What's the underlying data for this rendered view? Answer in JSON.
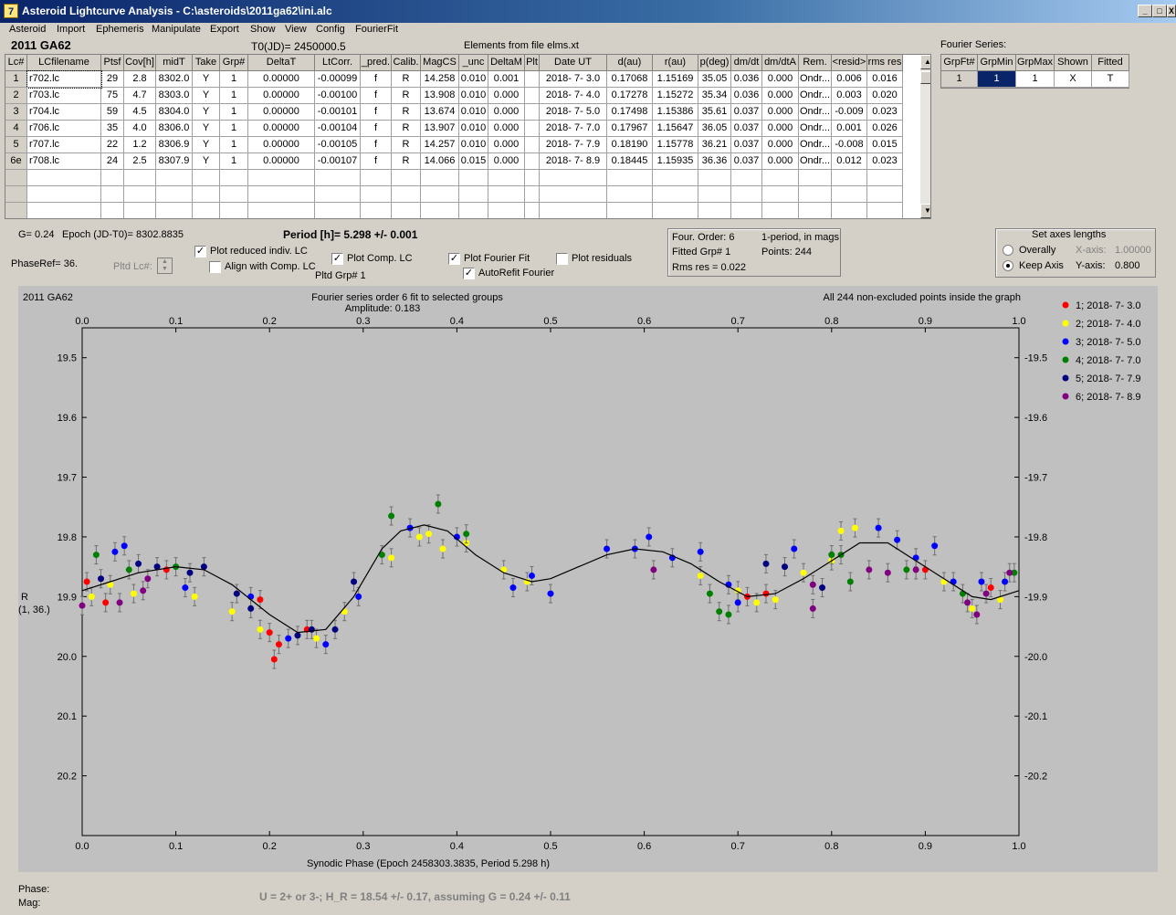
{
  "window": {
    "title": "Asteroid Lightcurve Analysis - C:\\asteroids\\2011ga62\\ini.alc",
    "min": "_",
    "max": "□",
    "close": "X"
  },
  "menu": [
    "Asteroid",
    "Import",
    "Ephemeris",
    "Manipulate",
    "Export",
    "Show",
    "View",
    "Config",
    "FourierFit"
  ],
  "header": {
    "asteroid": "2011 GA62",
    "t0": "T0(JD)= 2450000.5",
    "elements": "Elements from file elms.xt",
    "fourier_series": "Fourier Series:"
  },
  "table": {
    "columns": [
      "Lc#",
      "LCfilename",
      "Ptsf",
      "Cov[h]",
      "midT",
      "Take",
      "Grp#",
      "DeltaT",
      "LtCorr.",
      "_pred.",
      "Calib.",
      "MagCS",
      "_unc",
      "DeltaM",
      "Plt",
      "Date UT",
      "d(au)",
      "r(au)",
      "p(deg)",
      "dm/dt",
      "dm/dtA",
      "Rem.",
      "<resid>",
      "rms res"
    ],
    "rows": [
      [
        "1",
        "r702.lc",
        "29",
        "2.8",
        "8302.0",
        "Y",
        "1",
        "0.00000",
        "-0.00099",
        "f",
        "R",
        "14.258",
        "0.010",
        "0.001",
        "",
        "2018- 7- 3.0",
        "0.17068",
        "1.15169",
        "35.05",
        "0.036",
        "0.000",
        "Ondr...",
        "0.006",
        "0.016"
      ],
      [
        "2",
        "r703.lc",
        "75",
        "4.7",
        "8303.0",
        "Y",
        "1",
        "0.00000",
        "-0.00100",
        "f",
        "R",
        "13.908",
        "0.010",
        "0.000",
        "",
        "2018- 7- 4.0",
        "0.17278",
        "1.15272",
        "35.34",
        "0.036",
        "0.000",
        "Ondr...",
        "0.003",
        "0.020"
      ],
      [
        "3",
        "r704.lc",
        "59",
        "4.5",
        "8304.0",
        "Y",
        "1",
        "0.00000",
        "-0.00101",
        "f",
        "R",
        "13.674",
        "0.010",
        "0.000",
        "",
        "2018- 7- 5.0",
        "0.17498",
        "1.15386",
        "35.61",
        "0.037",
        "0.000",
        "Ondr...",
        "-0.009",
        "0.023"
      ],
      [
        "4",
        "r706.lc",
        "35",
        "4.0",
        "8306.0",
        "Y",
        "1",
        "0.00000",
        "-0.00104",
        "f",
        "R",
        "13.907",
        "0.010",
        "0.000",
        "",
        "2018- 7- 7.0",
        "0.17967",
        "1.15647",
        "36.05",
        "0.037",
        "0.000",
        "Ondr...",
        "0.001",
        "0.026"
      ],
      [
        "5",
        "r707.lc",
        "22",
        "1.2",
        "8306.9",
        "Y",
        "1",
        "0.00000",
        "-0.00105",
        "f",
        "R",
        "14.257",
        "0.010",
        "0.000",
        "",
        "2018- 7- 7.9",
        "0.18190",
        "1.15778",
        "36.21",
        "0.037",
        "0.000",
        "Ondr...",
        "-0.008",
        "0.015"
      ],
      [
        "6e",
        "r708.lc",
        "24",
        "2.5",
        "8307.9",
        "Y",
        "1",
        "0.00000",
        "-0.00107",
        "f",
        "R",
        "14.066",
        "0.015",
        "0.000",
        "",
        "2018- 7- 8.9",
        "0.18445",
        "1.15935",
        "36.36",
        "0.037",
        "0.000",
        "Ondr...",
        "0.012",
        "0.023"
      ]
    ]
  },
  "fourier_table": {
    "columns": [
      "GrpFt#",
      "GrpMin",
      "GrpMax",
      "Shown",
      "Fitted"
    ],
    "row": [
      "1",
      "1",
      "1",
      "X",
      "T"
    ]
  },
  "controls": {
    "g": "G= 0.24",
    "epoch": "Epoch (JD-T0)= 8302.8835",
    "period": "Period [h]= 5.298 +/- 0.001",
    "phaseref": "PhaseRef= 36.",
    "pltd_lc": "Pltd Lc#:",
    "plot_reduced": "Plot reduced indiv. LC",
    "align_comp": "Align with Comp. LC",
    "plot_comp": "Plot Comp. LC",
    "pltd_grp": "Pltd Grp#  1",
    "plot_fourier": "Plot Fourier Fit",
    "autorefit": "AutoRefit Fourier",
    "plot_residuals": "Plot residuals",
    "four_order": "Four. Order:  6",
    "one_period": "1-period, in mags",
    "fitted_grp": "Fitted Grp# 1",
    "points": "Points: 244",
    "rms_res": "Rms res      = 0.022",
    "axes_title": "Set axes lengths",
    "overally": "Overally",
    "keep_axis": "Keep Axis",
    "xaxis_label": "X-axis:",
    "xaxis_val": "1.00000",
    "yaxis_label": "Y-axis:",
    "yaxis_val": "0.800"
  },
  "footer": {
    "phase": "Phase:",
    "mag": "Mag:",
    "result": "U = 2+ or 3-; H_R = 18.54 +/- 0.17, assuming G = 0.24 +/- 0.11"
  },
  "colors": {
    "red": "#ff0000",
    "yellow": "#ffff00",
    "blue": "#0000ff",
    "green": "#008000",
    "navy": "#000080",
    "purple": "#800080"
  },
  "chart_data": {
    "type": "scatter",
    "corner_label": "2011 GA62",
    "title": "Fourier series order 6 fit to selected groups",
    "subtitle": "Amplitude: 0.183",
    "note": "All 244 non-excluded points inside the graph",
    "xlabel": "Synodic Phase (Epoch 2458303.3835, Period 5.298 h)",
    "ylabel": "R",
    "ylabel2": "(1, 36.)",
    "xlim": [
      0,
      1
    ],
    "ylim": [
      19.45,
      20.3
    ],
    "y_inverted": true,
    "xticks": [
      "0.0",
      "0.1",
      "0.2",
      "0.3",
      "0.4",
      "0.5",
      "0.6",
      "0.7",
      "0.8",
      "0.9",
      "1.0"
    ],
    "yticks": [
      "19.5",
      "19.6",
      "19.7",
      "19.8",
      "19.9",
      "20.0",
      "20.1",
      "20.2"
    ],
    "legend": [
      {
        "name": "1; 2018- 7- 3.0",
        "color": "#ff0000"
      },
      {
        "name": "2; 2018- 7- 4.0",
        "color": "#ffff00"
      },
      {
        "name": "3; 2018- 7- 5.0",
        "color": "#0000ff"
      },
      {
        "name": "4; 2018- 7- 7.0",
        "color": "#008000"
      },
      {
        "name": "5; 2018- 7- 7.9",
        "color": "#000080"
      },
      {
        "name": "6; 2018- 7- 8.9",
        "color": "#800080"
      }
    ],
    "fit_curve": [
      [
        0.0,
        19.89
      ],
      [
        0.03,
        19.875
      ],
      [
        0.06,
        19.86
      ],
      [
        0.1,
        19.85
      ],
      [
        0.13,
        19.855
      ],
      [
        0.16,
        19.88
      ],
      [
        0.2,
        19.93
      ],
      [
        0.23,
        19.96
      ],
      [
        0.26,
        19.955
      ],
      [
        0.29,
        19.9
      ],
      [
        0.32,
        19.82
      ],
      [
        0.34,
        19.79
      ],
      [
        0.365,
        19.78
      ],
      [
        0.39,
        19.79
      ],
      [
        0.42,
        19.83
      ],
      [
        0.45,
        19.86
      ],
      [
        0.48,
        19.875
      ],
      [
        0.5,
        19.87
      ],
      [
        0.53,
        19.85
      ],
      [
        0.56,
        19.83
      ],
      [
        0.59,
        19.82
      ],
      [
        0.62,
        19.825
      ],
      [
        0.65,
        19.845
      ],
      [
        0.68,
        19.875
      ],
      [
        0.71,
        19.9
      ],
      [
        0.74,
        19.895
      ],
      [
        0.77,
        19.87
      ],
      [
        0.8,
        19.84
      ],
      [
        0.83,
        19.81
      ],
      [
        0.86,
        19.81
      ],
      [
        0.89,
        19.84
      ],
      [
        0.92,
        19.87
      ],
      [
        0.95,
        19.9
      ],
      [
        0.97,
        19.905
      ],
      [
        1.0,
        19.89
      ]
    ],
    "points": [
      {
        "g": 1,
        "x": 0.005,
        "y": 19.875
      },
      {
        "g": 1,
        "x": 0.025,
        "y": 19.91
      },
      {
        "g": 1,
        "x": 0.09,
        "y": 19.855
      },
      {
        "g": 1,
        "x": 0.19,
        "y": 19.905
      },
      {
        "g": 1,
        "x": 0.2,
        "y": 19.96
      },
      {
        "g": 1,
        "x": 0.205,
        "y": 20.005
      },
      {
        "g": 1,
        "x": 0.21,
        "y": 19.98
      },
      {
        "g": 1,
        "x": 0.24,
        "y": 19.955
      },
      {
        "g": 1,
        "x": 0.71,
        "y": 19.9
      },
      {
        "g": 1,
        "x": 0.73,
        "y": 19.895
      },
      {
        "g": 1,
        "x": 0.9,
        "y": 19.855
      },
      {
        "g": 1,
        "x": 0.97,
        "y": 19.885
      },
      {
        "g": 2,
        "x": 0.01,
        "y": 19.9
      },
      {
        "g": 2,
        "x": 0.03,
        "y": 19.88
      },
      {
        "g": 2,
        "x": 0.055,
        "y": 19.895
      },
      {
        "g": 2,
        "x": 0.12,
        "y": 19.9
      },
      {
        "g": 2,
        "x": 0.16,
        "y": 19.925
      },
      {
        "g": 2,
        "x": 0.19,
        "y": 19.955
      },
      {
        "g": 2,
        "x": 0.25,
        "y": 19.97
      },
      {
        "g": 2,
        "x": 0.28,
        "y": 19.925
      },
      {
        "g": 2,
        "x": 0.33,
        "y": 19.835
      },
      {
        "g": 2,
        "x": 0.36,
        "y": 19.8
      },
      {
        "g": 2,
        "x": 0.37,
        "y": 19.795
      },
      {
        "g": 2,
        "x": 0.385,
        "y": 19.82
      },
      {
        "g": 2,
        "x": 0.41,
        "y": 19.81
      },
      {
        "g": 2,
        "x": 0.45,
        "y": 19.855
      },
      {
        "g": 2,
        "x": 0.475,
        "y": 19.875
      },
      {
        "g": 2,
        "x": 0.66,
        "y": 19.865
      },
      {
        "g": 2,
        "x": 0.7,
        "y": 19.89
      },
      {
        "g": 2,
        "x": 0.72,
        "y": 19.91
      },
      {
        "g": 2,
        "x": 0.74,
        "y": 19.905
      },
      {
        "g": 2,
        "x": 0.77,
        "y": 19.86
      },
      {
        "g": 2,
        "x": 0.8,
        "y": 19.84
      },
      {
        "g": 2,
        "x": 0.81,
        "y": 19.79
      },
      {
        "g": 2,
        "x": 0.825,
        "y": 19.785
      },
      {
        "g": 2,
        "x": 0.92,
        "y": 19.875
      },
      {
        "g": 2,
        "x": 0.95,
        "y": 19.92
      },
      {
        "g": 2,
        "x": 0.98,
        "y": 19.905
      },
      {
        "g": 3,
        "x": 0.035,
        "y": 19.825
      },
      {
        "g": 3,
        "x": 0.045,
        "y": 19.815
      },
      {
        "g": 3,
        "x": 0.11,
        "y": 19.885
      },
      {
        "g": 3,
        "x": 0.18,
        "y": 19.9
      },
      {
        "g": 3,
        "x": 0.22,
        "y": 19.97
      },
      {
        "g": 3,
        "x": 0.26,
        "y": 19.98
      },
      {
        "g": 3,
        "x": 0.295,
        "y": 19.9
      },
      {
        "g": 3,
        "x": 0.35,
        "y": 19.785
      },
      {
        "g": 3,
        "x": 0.4,
        "y": 19.8
      },
      {
        "g": 3,
        "x": 0.46,
        "y": 19.885
      },
      {
        "g": 3,
        "x": 0.48,
        "y": 19.865
      },
      {
        "g": 3,
        "x": 0.5,
        "y": 19.895
      },
      {
        "g": 3,
        "x": 0.56,
        "y": 19.82
      },
      {
        "g": 3,
        "x": 0.59,
        "y": 19.82
      },
      {
        "g": 3,
        "x": 0.605,
        "y": 19.8
      },
      {
        "g": 3,
        "x": 0.63,
        "y": 19.835
      },
      {
        "g": 3,
        "x": 0.66,
        "y": 19.825
      },
      {
        "g": 3,
        "x": 0.69,
        "y": 19.88
      },
      {
        "g": 3,
        "x": 0.7,
        "y": 19.91
      },
      {
        "g": 3,
        "x": 0.76,
        "y": 19.82
      },
      {
        "g": 3,
        "x": 0.85,
        "y": 19.785
      },
      {
        "g": 3,
        "x": 0.87,
        "y": 19.805
      },
      {
        "g": 3,
        "x": 0.89,
        "y": 19.835
      },
      {
        "g": 3,
        "x": 0.91,
        "y": 19.815
      },
      {
        "g": 3,
        "x": 0.93,
        "y": 19.875
      },
      {
        "g": 3,
        "x": 0.96,
        "y": 19.875
      },
      {
        "g": 3,
        "x": 0.985,
        "y": 19.875
      },
      {
        "g": 4,
        "x": 0.015,
        "y": 19.83
      },
      {
        "g": 4,
        "x": 0.05,
        "y": 19.855
      },
      {
        "g": 4,
        "x": 0.1,
        "y": 19.85
      },
      {
        "g": 4,
        "x": 0.32,
        "y": 19.83
      },
      {
        "g": 4,
        "x": 0.33,
        "y": 19.765
      },
      {
        "g": 4,
        "x": 0.38,
        "y": 19.745
      },
      {
        "g": 4,
        "x": 0.41,
        "y": 19.795
      },
      {
        "g": 4,
        "x": 0.68,
        "y": 19.925
      },
      {
        "g": 4,
        "x": 0.69,
        "y": 19.93
      },
      {
        "g": 4,
        "x": 0.67,
        "y": 19.895
      },
      {
        "g": 4,
        "x": 0.8,
        "y": 19.83
      },
      {
        "g": 4,
        "x": 0.81,
        "y": 19.83
      },
      {
        "g": 4,
        "x": 0.82,
        "y": 19.875
      },
      {
        "g": 4,
        "x": 0.88,
        "y": 19.855
      },
      {
        "g": 4,
        "x": 0.94,
        "y": 19.895
      },
      {
        "g": 4,
        "x": 0.995,
        "y": 19.86
      },
      {
        "g": 5,
        "x": 0.02,
        "y": 19.87
      },
      {
        "g": 5,
        "x": 0.06,
        "y": 19.845
      },
      {
        "g": 5,
        "x": 0.08,
        "y": 19.85
      },
      {
        "g": 5,
        "x": 0.115,
        "y": 19.86
      },
      {
        "g": 5,
        "x": 0.13,
        "y": 19.85
      },
      {
        "g": 5,
        "x": 0.165,
        "y": 19.895
      },
      {
        "g": 5,
        "x": 0.18,
        "y": 19.92
      },
      {
        "g": 5,
        "x": 0.23,
        "y": 19.965
      },
      {
        "g": 5,
        "x": 0.245,
        "y": 19.955
      },
      {
        "g": 5,
        "x": 0.27,
        "y": 19.955
      },
      {
        "g": 5,
        "x": 0.29,
        "y": 19.875
      },
      {
        "g": 5,
        "x": 0.73,
        "y": 19.845
      },
      {
        "g": 5,
        "x": 0.75,
        "y": 19.85
      },
      {
        "g": 5,
        "x": 0.79,
        "y": 19.885
      },
      {
        "g": 6,
        "x": 0.0,
        "y": 19.915
      },
      {
        "g": 6,
        "x": 0.04,
        "y": 19.91
      },
      {
        "g": 6,
        "x": 0.065,
        "y": 19.89
      },
      {
        "g": 6,
        "x": 0.07,
        "y": 19.87
      },
      {
        "g": 6,
        "x": 0.61,
        "y": 19.855
      },
      {
        "g": 6,
        "x": 0.78,
        "y": 19.88
      },
      {
        "g": 6,
        "x": 0.78,
        "y": 19.92
      },
      {
        "g": 6,
        "x": 0.84,
        "y": 19.855
      },
      {
        "g": 6,
        "x": 0.86,
        "y": 19.86
      },
      {
        "g": 6,
        "x": 0.89,
        "y": 19.855
      },
      {
        "g": 6,
        "x": 0.945,
        "y": 19.91
      },
      {
        "g": 6,
        "x": 0.955,
        "y": 19.93
      },
      {
        "g": 6,
        "x": 0.965,
        "y": 19.895
      },
      {
        "g": 6,
        "x": 0.99,
        "y": 19.86
      }
    ]
  }
}
